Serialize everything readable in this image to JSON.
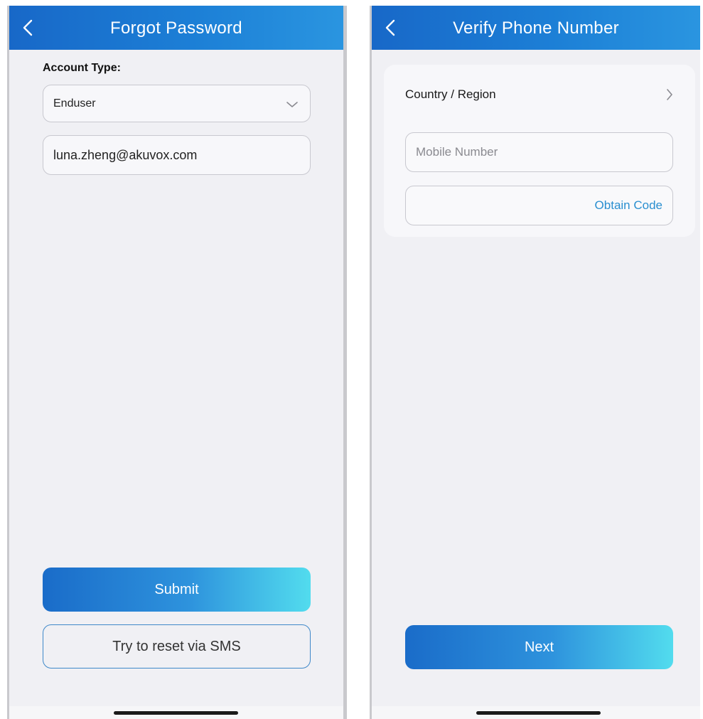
{
  "forgot_password": {
    "header": {
      "title": "Forgot Password"
    },
    "account_type_label": "Account Type:",
    "account_type_select": {
      "value": "Enduser"
    },
    "email_field": {
      "value": "luna.zheng@akuvox.com"
    },
    "submit_label": "Submit",
    "sms_reset_label": "Try to reset via SMS"
  },
  "verify_phone": {
    "header": {
      "title": "Verify Phone Number"
    },
    "country_region_label": "Country / Region",
    "mobile_number": {
      "placeholder": "Mobile Number",
      "value": ""
    },
    "obtain_code_label": "Obtain Code",
    "next_label": "Next"
  },
  "colors": {
    "header_gradient": [
      "#1868c8",
      "#2a95e0"
    ],
    "button_gradient": [
      "#1a6cc9",
      "#52dcee"
    ],
    "link_blue": "#2a8fd0",
    "background": "#f0f0f4"
  },
  "icons": {
    "back": "chevron-left-icon",
    "dropdown": "chevron-down-icon",
    "row_arrow": "chevron-right-icon"
  }
}
